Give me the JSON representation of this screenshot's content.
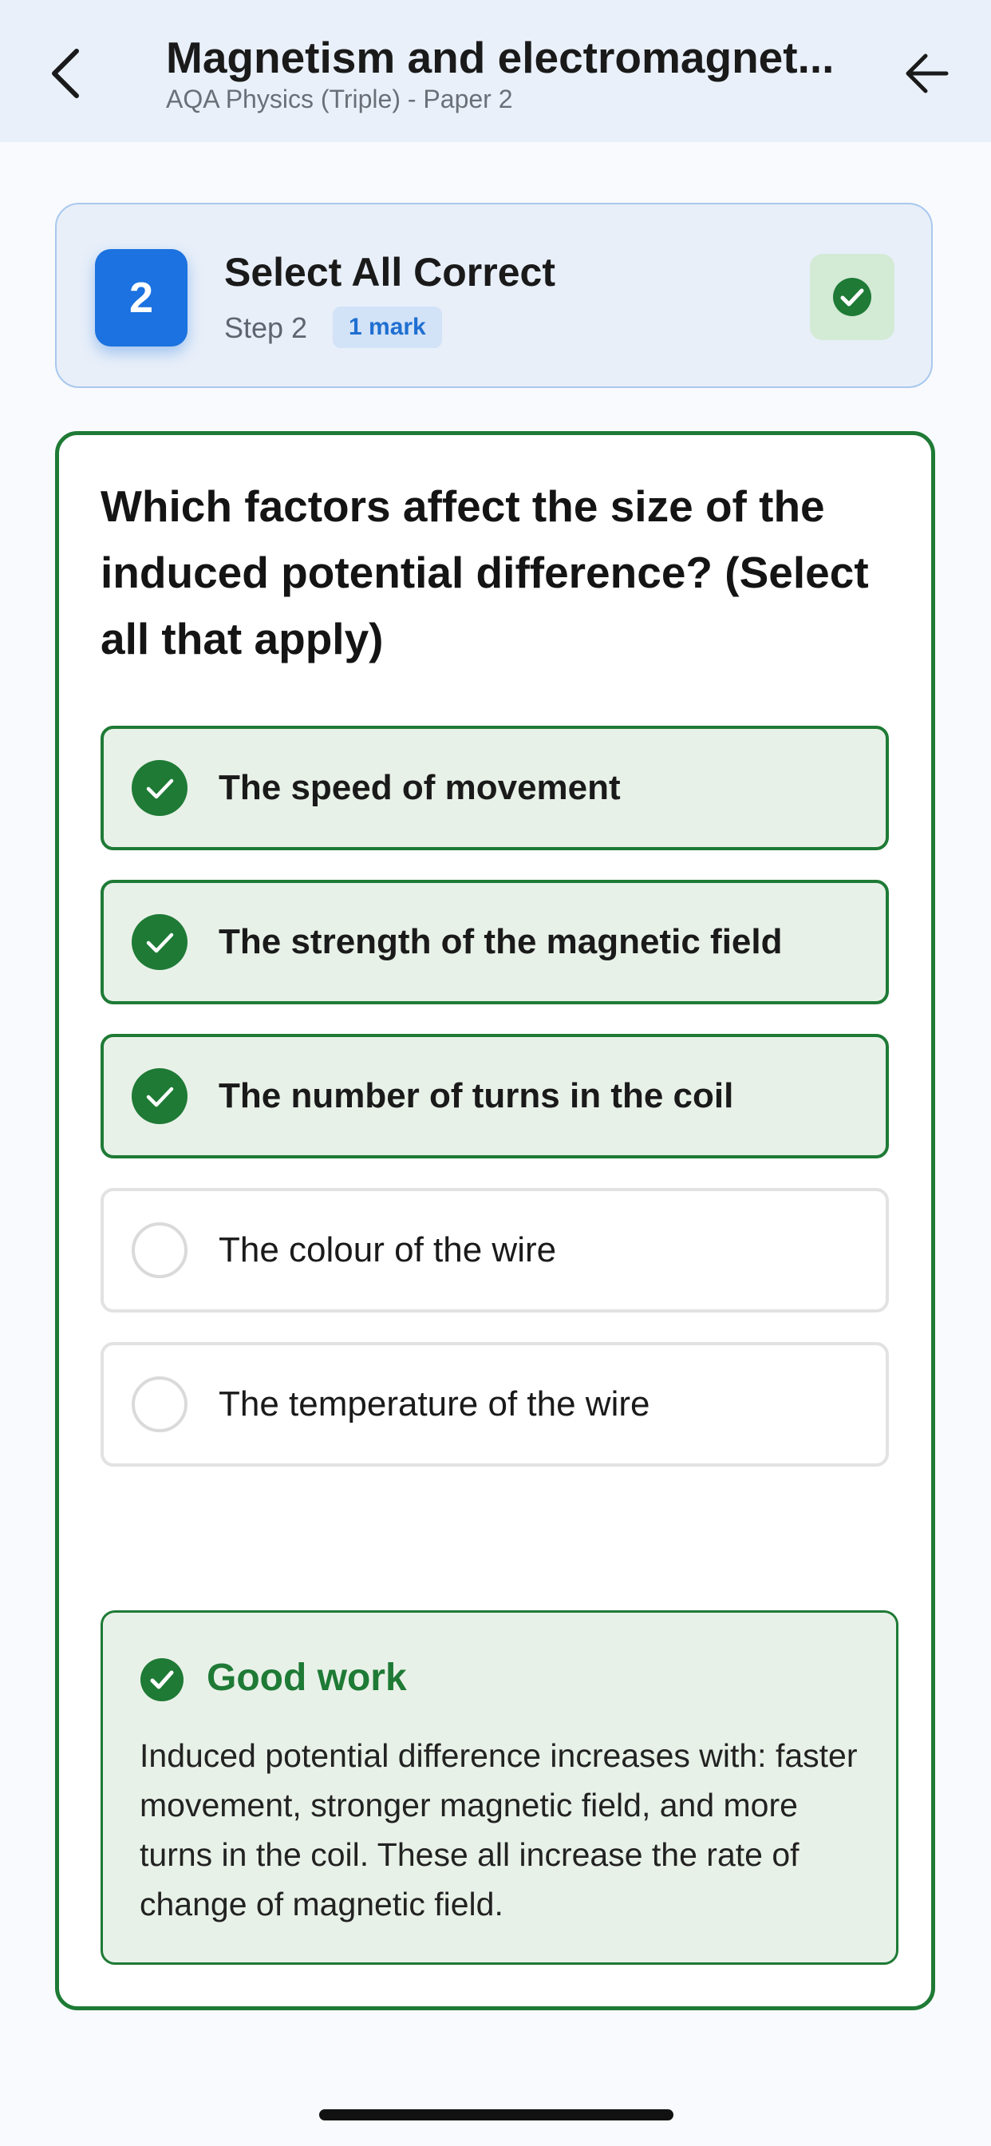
{
  "header": {
    "title": "Magnetism and electromagnet...",
    "subtitle": "AQA Physics (Triple) - Paper 2",
    "back_icon": "chevron-left-icon",
    "nav_icon": "arrow-left-icon"
  },
  "step": {
    "number": "2",
    "title": "Select All Correct",
    "label": "Step 2",
    "marks": "1 mark",
    "status_icon": "check-circle-icon"
  },
  "question": {
    "text": "Which factors affect the size of the induced potential difference? (Select all that apply)",
    "options": [
      {
        "label": "The speed of movement",
        "state": "correct"
      },
      {
        "label": "The strength of the magnetic field",
        "state": "correct"
      },
      {
        "label": "The number of turns in the coil",
        "state": "correct"
      },
      {
        "label": "The colour of the wire",
        "state": "unselected"
      },
      {
        "label": "The temperature of the wire",
        "state": "unselected"
      }
    ]
  },
  "feedback": {
    "title": "Good work",
    "text": "Induced potential difference increases with: faster movement, stronger magnetic field, and more turns in the coil. These all increase the rate of change of magnetic field."
  },
  "colors": {
    "accent_blue": "#1b72e0",
    "success_green": "#1e7a35",
    "success_bg": "#e8f1e8",
    "header_bg": "#e9f0fa"
  }
}
